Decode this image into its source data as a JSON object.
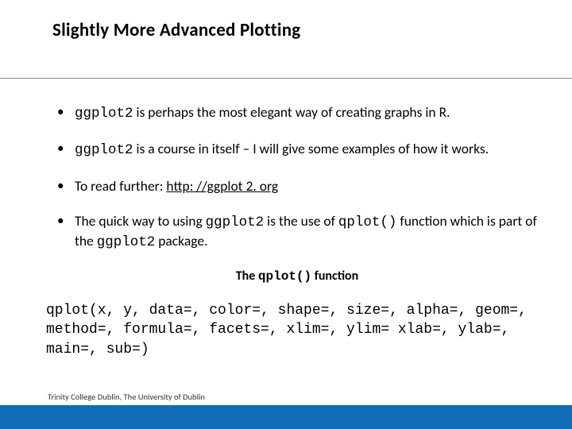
{
  "title": "Slightly More Advanced Plotting",
  "bullets": {
    "b1": {
      "code": "ggplot2",
      "rest": " is perhaps the most elegant way of creating graphs in R."
    },
    "b2": {
      "code": "ggplot2",
      "rest": " is a course in itself – I will give some examples of how it works."
    },
    "b3": {
      "lead": "To read further: ",
      "link": "http: //ggplot 2. org"
    },
    "b4": {
      "p1": "The quick way to using ",
      "c1": "ggplot2",
      "p2": " is the use of ",
      "c2": "qplot()",
      "p3": " function which is part of the ",
      "c3": "ggplot2",
      "p4": " package."
    }
  },
  "subheading": {
    "lead": "The ",
    "code": "qplot()",
    "tail": " function"
  },
  "codeblock": "qplot(x, y, data=, color=, shape=, size=, alpha=, geom=, method=, formula=, facets=, xlim=, ylim= xlab=, ylab=, main=, sub=)",
  "footer": "Trinity College Dublin, The University of Dublin"
}
